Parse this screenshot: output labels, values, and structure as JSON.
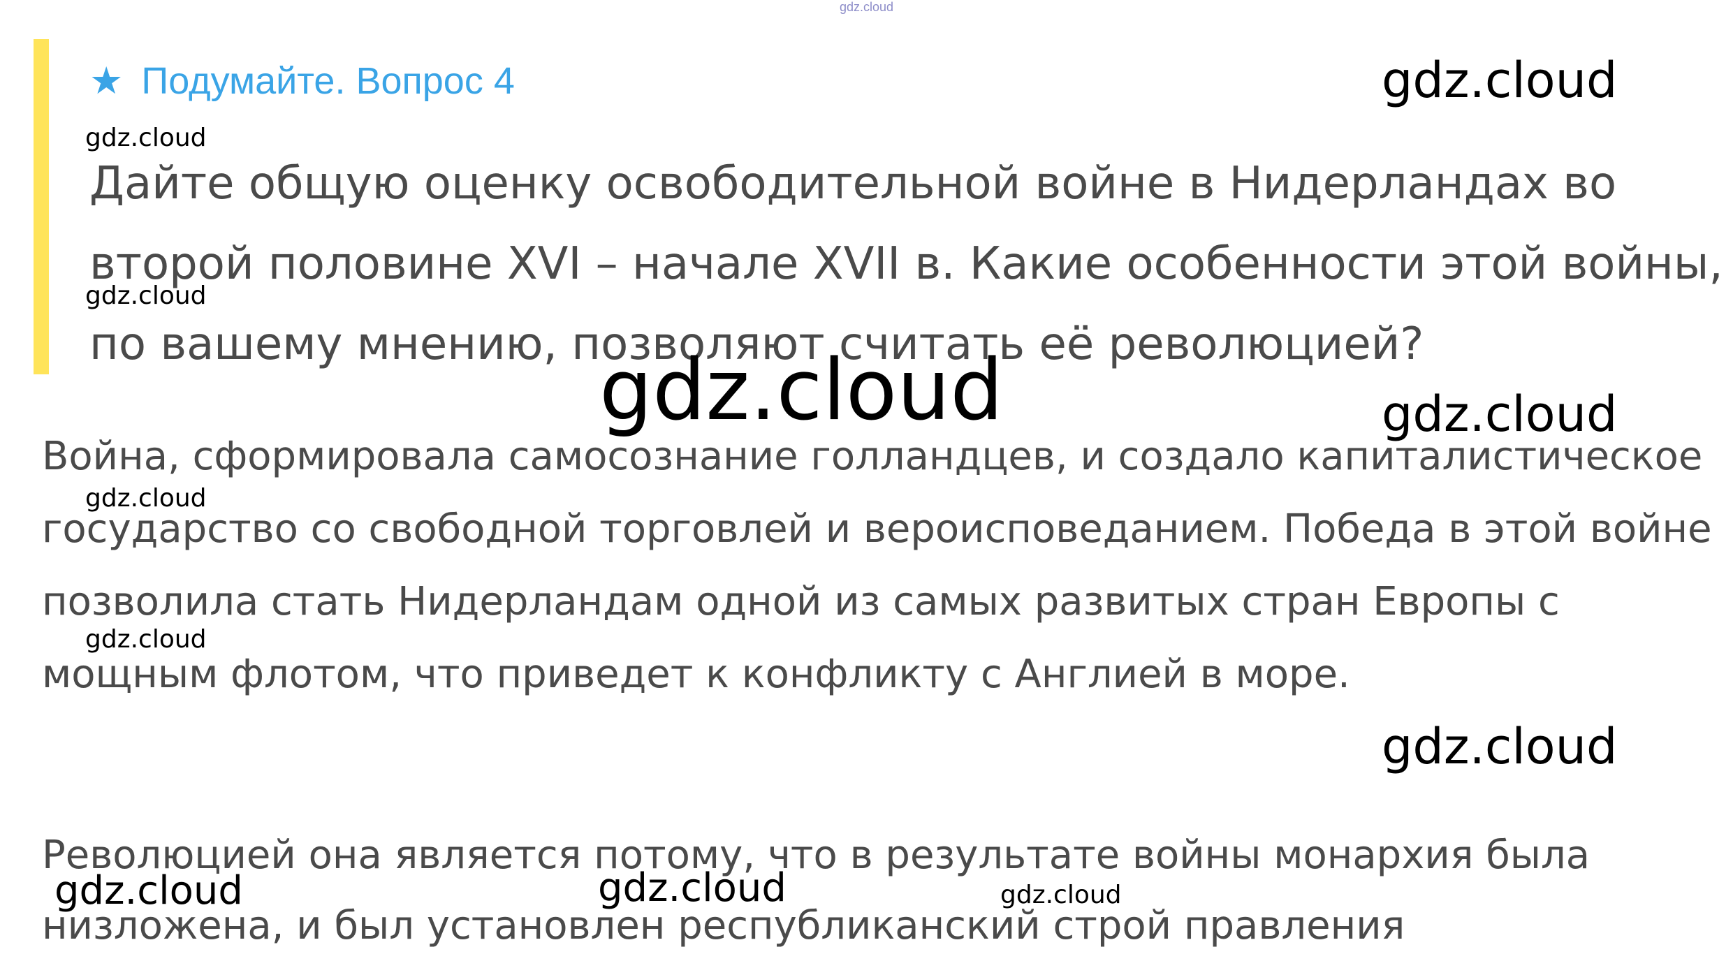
{
  "top_mark": "gdz.cloud",
  "question": {
    "star": "★",
    "title": "Подумайте. Вопрос 4",
    "text": "Дайте общую оценку освободительной войне в Нидерландах во второй половине XVI – начале XVII в. Какие особенности этой войны, по вашему мнению, позволяют считать её революцией?"
  },
  "answer": {
    "paragraph_1": "Война, сформировала самосознание голландцев, и создало капиталистическое государство со свободной торговлей и вероисповеданием. Победа в этой войне позволила стать Нидерландам одной из самых развитых стран Европы с мощным флотом, что приведет к конфликту с Англией в море.",
    "paragraph_2": "Революцией она является потому, что в результате войны монархия была низложена, и был установлен республиканский строй правления"
  },
  "watermarks": [
    "gdz.cloud",
    "gdz.cloud",
    "gdz.cloud",
    "gdz.cloud",
    "gdz.cloud",
    "gdz.cloud",
    "gdz.cloud",
    "gdz.cloud",
    "gdz.cloud",
    "gdz.cloud",
    "gdz.cloud",
    "gdz.cloud"
  ],
  "colors": {
    "accent_bar": "#ffe45a",
    "header": "#3aa4e6",
    "text": "#4a4a4a"
  }
}
